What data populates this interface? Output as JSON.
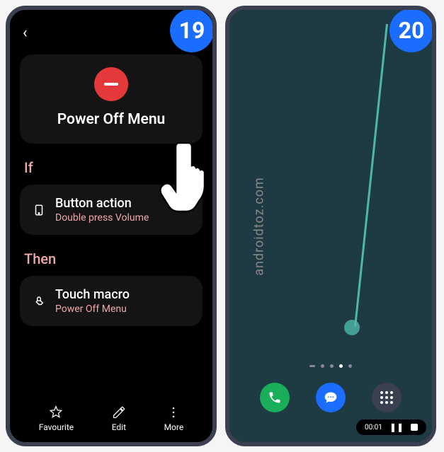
{
  "badges": {
    "left": "19",
    "right": "20"
  },
  "watermark": "androidtoz.com",
  "screen19": {
    "title": "Power Off Menu",
    "if_label": "If",
    "then_label": "Then",
    "if_action": {
      "title": "Button action",
      "sub": "Double press Volume"
    },
    "then_action": {
      "title": "Touch macro",
      "sub": "Power Off Menu"
    },
    "nav": {
      "fav": "Favourite",
      "edit": "Edit",
      "more": "More"
    }
  },
  "screen20": {
    "media_time": "00:01"
  }
}
